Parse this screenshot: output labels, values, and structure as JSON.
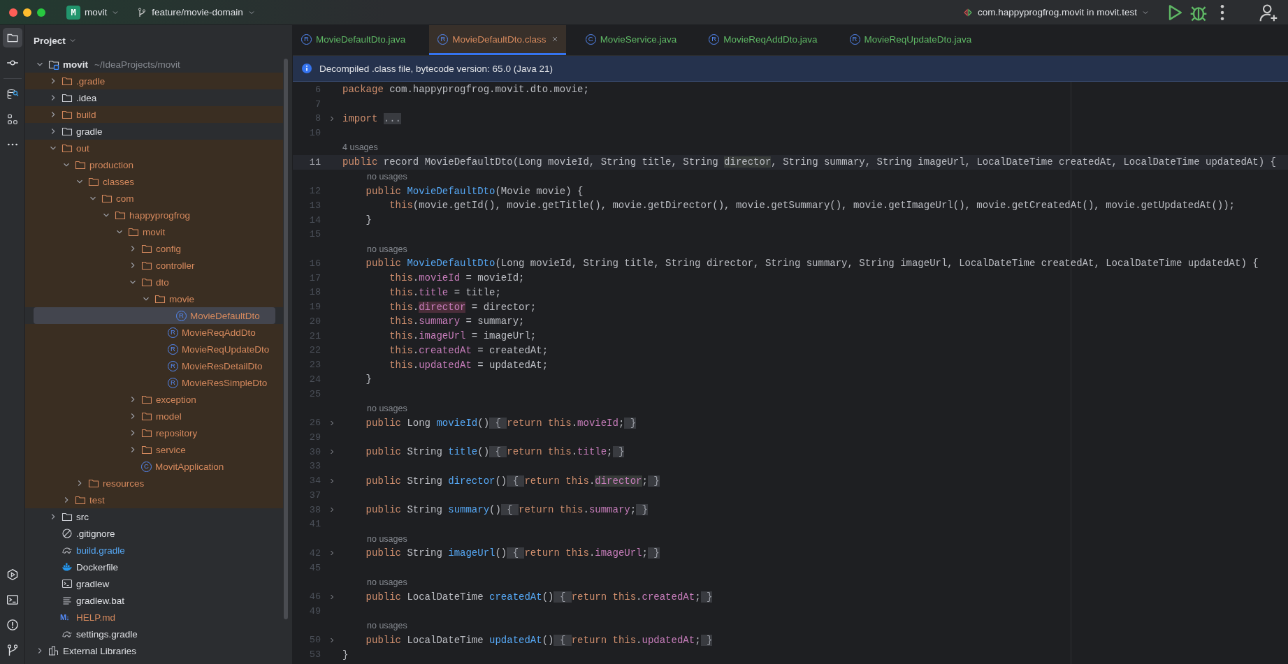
{
  "title_bar": {
    "project": {
      "glyph": "M",
      "label": "movit"
    },
    "branch": "feature/movie-domain",
    "run_config": "com.happyprogfrog.movit in movit.test"
  },
  "tool_strip": {
    "top": [
      {
        "kind": "folder",
        "selected": true
      },
      {
        "kind": "commit",
        "selected": false
      },
      {
        "kind": "database",
        "selected": false
      },
      {
        "kind": "structure",
        "selected": false
      },
      {
        "kind": "more",
        "selected": false
      }
    ],
    "bottom": [
      {
        "kind": "services",
        "selected": false
      },
      {
        "kind": "terminal",
        "selected": false
      },
      {
        "kind": "problems",
        "selected": false
      },
      {
        "kind": "git",
        "selected": false
      }
    ]
  },
  "project_panel": {
    "title": "Project",
    "tree": [
      {
        "label": "movit",
        "path": "~/IdeaProjects/movit",
        "kind": "module",
        "expanded": true,
        "highlighted": false,
        "ignored": false,
        "modified": false,
        "selected": false,
        "children": [
          {
            "label": ".gradle",
            "kind": "folder",
            "expanded": false,
            "highlighted": true,
            "ignored": true,
            "modified": false,
            "selected": false
          },
          {
            "label": ".idea",
            "kind": "folder",
            "expanded": false,
            "highlighted": false,
            "ignored": false,
            "modified": false,
            "selected": false
          },
          {
            "label": "build",
            "kind": "folder",
            "expanded": false,
            "highlighted": true,
            "ignored": true,
            "modified": false,
            "selected": false
          },
          {
            "label": "gradle",
            "kind": "folder",
            "expanded": false,
            "highlighted": false,
            "ignored": false,
            "modified": false,
            "selected": false
          },
          {
            "label": "out",
            "kind": "folder",
            "expanded": true,
            "highlighted": true,
            "ignored": true,
            "modified": false,
            "selected": false,
            "children": [
              {
                "label": "production",
                "kind": "folder",
                "expanded": true,
                "highlighted": true,
                "ignored": true,
                "modified": false,
                "selected": false,
                "children": [
                  {
                    "label": "classes",
                    "kind": "folder",
                    "expanded": true,
                    "highlighted": true,
                    "ignored": true,
                    "modified": false,
                    "selected": false,
                    "children": [
                      {
                        "label": "com",
                        "kind": "folder",
                        "expanded": true,
                        "highlighted": true,
                        "ignored": true,
                        "modified": false,
                        "selected": false,
                        "children": [
                          {
                            "label": "happyprogfrog",
                            "kind": "folder",
                            "expanded": true,
                            "highlighted": true,
                            "ignored": true,
                            "modified": false,
                            "selected": false,
                            "children": [
                              {
                                "label": "movit",
                                "kind": "folder",
                                "expanded": true,
                                "highlighted": true,
                                "ignored": true,
                                "modified": false,
                                "selected": false,
                                "children": [
                                  {
                                    "label": "config",
                                    "kind": "folder",
                                    "expanded": false,
                                    "highlighted": true,
                                    "ignored": true,
                                    "modified": false,
                                    "selected": false
                                  },
                                  {
                                    "label": "controller",
                                    "kind": "folder",
                                    "expanded": false,
                                    "highlighted": true,
                                    "ignored": true,
                                    "modified": false,
                                    "selected": false
                                  },
                                  {
                                    "label": "dto",
                                    "kind": "folder",
                                    "expanded": true,
                                    "highlighted": true,
                                    "ignored": true,
                                    "modified": false,
                                    "selected": false,
                                    "children": [
                                      {
                                        "label": "movie",
                                        "kind": "folder",
                                        "expanded": true,
                                        "highlighted": true,
                                        "ignored": true,
                                        "modified": false,
                                        "selected": false,
                                        "children": [
                                          {
                                            "label": "MovieDefaultDto",
                                            "kind": "record",
                                            "glyph": "R",
                                            "highlighted": true,
                                            "ignored": true,
                                            "modified": false,
                                            "selected": true
                                          },
                                          {
                                            "label": "MovieReqAddDto",
                                            "kind": "record",
                                            "glyph": "R",
                                            "highlighted": true,
                                            "ignored": true,
                                            "modified": false,
                                            "selected": false
                                          },
                                          {
                                            "label": "MovieReqUpdateDto",
                                            "kind": "record",
                                            "glyph": "R",
                                            "highlighted": true,
                                            "ignored": true,
                                            "modified": false,
                                            "selected": false
                                          },
                                          {
                                            "label": "MovieResDetailDto",
                                            "kind": "record",
                                            "glyph": "R",
                                            "highlighted": true,
                                            "ignored": true,
                                            "modified": false,
                                            "selected": false
                                          },
                                          {
                                            "label": "MovieResSimpleDto",
                                            "kind": "record",
                                            "glyph": "R",
                                            "highlighted": true,
                                            "ignored": true,
                                            "modified": false,
                                            "selected": false
                                          }
                                        ]
                                      }
                                    ]
                                  },
                                  {
                                    "label": "exception",
                                    "kind": "folder",
                                    "expanded": false,
                                    "highlighted": true,
                                    "ignored": true,
                                    "modified": false,
                                    "selected": false
                                  },
                                  {
                                    "label": "model",
                                    "kind": "folder",
                                    "expanded": false,
                                    "highlighted": true,
                                    "ignored": true,
                                    "modified": false,
                                    "selected": false
                                  },
                                  {
                                    "label": "repository",
                                    "kind": "folder",
                                    "expanded": false,
                                    "highlighted": true,
                                    "ignored": true,
                                    "modified": false,
                                    "selected": false
                                  },
                                  {
                                    "label": "service",
                                    "kind": "folder",
                                    "expanded": false,
                                    "highlighted": true,
                                    "ignored": true,
                                    "modified": false,
                                    "selected": false
                                  },
                                  {
                                    "label": "MovitApplication",
                                    "kind": "class",
                                    "glyph": "C",
                                    "highlighted": true,
                                    "ignored": true,
                                    "modified": false,
                                    "selected": false
                                  }
                                ]
                              }
                            ]
                          }
                        ]
                      }
                    ]
                  },
                  {
                    "label": "resources",
                    "kind": "folder",
                    "expanded": false,
                    "highlighted": true,
                    "ignored": true,
                    "modified": false,
                    "selected": false
                  }
                ]
              },
              {
                "label": "test",
                "kind": "folder",
                "expanded": false,
                "highlighted": true,
                "ignored": true,
                "modified": false,
                "selected": false
              }
            ]
          },
          {
            "label": "src",
            "kind": "folder",
            "expanded": false,
            "highlighted": false,
            "ignored": false,
            "modified": false,
            "selected": false
          },
          {
            "label": ".gitignore",
            "kind": "gitignore",
            "highlighted": false,
            "ignored": false,
            "modified": false,
            "selected": false
          },
          {
            "label": "build.gradle",
            "kind": "gradle",
            "highlighted": false,
            "ignored": false,
            "modified": true,
            "selected": false
          },
          {
            "label": "Dockerfile",
            "kind": "docker",
            "highlighted": false,
            "ignored": false,
            "modified": false,
            "selected": false
          },
          {
            "label": "gradlew",
            "kind": "script",
            "highlighted": false,
            "ignored": false,
            "modified": false,
            "selected": false
          },
          {
            "label": "gradlew.bat",
            "kind": "text",
            "highlighted": false,
            "ignored": false,
            "modified": false,
            "selected": false
          },
          {
            "label": "HELP.md",
            "kind": "markdown",
            "glyph": "M↓",
            "highlighted": false,
            "ignored": true,
            "modified": false,
            "selected": false
          },
          {
            "label": "settings.gradle",
            "kind": "gradle",
            "highlighted": false,
            "ignored": false,
            "modified": false,
            "selected": false
          }
        ]
      },
      {
        "label": "External Libraries",
        "kind": "library",
        "expanded": false,
        "highlighted": false,
        "ignored": false,
        "modified": false,
        "selected": false
      }
    ]
  },
  "tabs": [
    {
      "label": "MovieDefaultDto.java",
      "glyph": "R",
      "ignored": false,
      "selected": false
    },
    {
      "label": "MovieDefaultDto.class",
      "glyph": "R",
      "ignored": true,
      "selected": true
    },
    {
      "label": "MovieService.java",
      "glyph": "C",
      "ignored": false,
      "selected": false
    },
    {
      "label": "MovieReqAddDto.java",
      "glyph": "R",
      "ignored": false,
      "selected": false
    },
    {
      "label": "MovieReqUpdateDto.java",
      "glyph": "R",
      "ignored": false,
      "selected": false
    }
  ],
  "banner": "Decompiled .class file, bytecode version: 65.0 (Java 21)",
  "code": [
    {
      "number": "6",
      "kind": "declaration",
      "fold": false,
      "current": false,
      "tokens": [
        {
          "kind": "kw",
          "text": "package"
        },
        {
          "kind": "pl",
          "text": " com.happyprogfrog.movit.dto.movie;"
        }
      ]
    },
    {
      "number": "7",
      "fold": false,
      "current": false
    },
    {
      "number": "8",
      "kind": "declaration",
      "fold": true,
      "current": false,
      "tokens": [
        {
          "kind": "kw",
          "text": "import"
        },
        {
          "kind": "fold",
          "text": "..."
        }
      ]
    },
    {
      "number": "10",
      "fold": false,
      "current": false
    },
    {
      "hint": "4 usages",
      "kind": "declaration"
    },
    {
      "number": "11",
      "kind": "declaration",
      "fold": false,
      "current": true,
      "tokens": [
        {
          "kind": "kw",
          "text": "public"
        },
        {
          "kind": "pl",
          "text": " record MovieDefaultDto(Long movieId, String title, String "
        },
        {
          "kind": "occ",
          "text": "director"
        },
        {
          "kind": "pl",
          "text": ", String summary, String imageUrl, LocalDateTime createdAt, LocalDateTime updatedAt) {"
        }
      ]
    },
    {
      "hint": "no usages",
      "kind": "member"
    },
    {
      "number": "12",
      "kind": "member",
      "fold": false,
      "current": false,
      "tokens": [
        {
          "kind": "kw",
          "text": "public "
        },
        {
          "kind": "fn",
          "text": "MovieDefaultDto"
        },
        {
          "kind": "pl",
          "text": "(Movie movie) {"
        }
      ]
    },
    {
      "number": "13",
      "kind": "statement",
      "fold": false,
      "current": false,
      "tokens": [
        {
          "kind": "kw",
          "text": "this"
        },
        {
          "kind": "pl",
          "text": "(movie.getId(), movie.getTitle(), movie.getDirector(), movie.getSummary(), movie.getImageUrl(), movie.getCreatedAt(), movie.getUpdatedAt());"
        }
      ]
    },
    {
      "number": "14",
      "kind": "member",
      "fold": false,
      "current": false,
      "tokens": [
        {
          "kind": "pl",
          "text": "}"
        }
      ]
    },
    {
      "number": "15",
      "fold": false,
      "current": false
    },
    {
      "hint": "no usages",
      "kind": "member"
    },
    {
      "number": "16",
      "kind": "member",
      "fold": false,
      "current": false,
      "tokens": [
        {
          "kind": "kw",
          "text": "public "
        },
        {
          "kind": "fn",
          "text": "MovieDefaultDto"
        },
        {
          "kind": "pl",
          "text": "(Long movieId, String title, String director, String summary, String imageUrl, LocalDateTime createdAt, LocalDateTime updatedAt) {"
        }
      ]
    },
    {
      "number": "17",
      "kind": "statement",
      "fold": false,
      "current": false,
      "tokens": [
        {
          "kind": "kw",
          "text": "this"
        },
        {
          "kind": "pl",
          "text": "."
        },
        {
          "kind": "fd",
          "text": "movieId"
        },
        {
          "kind": "pl",
          "text": " = movieId;"
        }
      ]
    },
    {
      "number": "18",
      "kind": "statement",
      "fold": false,
      "current": false,
      "tokens": [
        {
          "kind": "kw",
          "text": "this"
        },
        {
          "kind": "pl",
          "text": "."
        },
        {
          "kind": "fd",
          "text": "title"
        },
        {
          "kind": "pl",
          "text": " = title;"
        }
      ]
    },
    {
      "number": "19",
      "kind": "statement",
      "fold": false,
      "current": false,
      "tokens": [
        {
          "kind": "kw",
          "text": "this"
        },
        {
          "kind": "pl",
          "text": "."
        },
        {
          "kind": "fd-write",
          "text": "director"
        },
        {
          "kind": "pl",
          "text": " = director;"
        }
      ]
    },
    {
      "number": "20",
      "kind": "statement",
      "fold": false,
      "current": false,
      "tokens": [
        {
          "kind": "kw",
          "text": "this"
        },
        {
          "kind": "pl",
          "text": "."
        },
        {
          "kind": "fd",
          "text": "summary"
        },
        {
          "kind": "pl",
          "text": " = summary;"
        }
      ]
    },
    {
      "number": "21",
      "kind": "statement",
      "fold": false,
      "current": false,
      "tokens": [
        {
          "kind": "kw",
          "text": "this"
        },
        {
          "kind": "pl",
          "text": "."
        },
        {
          "kind": "fd",
          "text": "imageUrl"
        },
        {
          "kind": "pl",
          "text": " = imageUrl;"
        }
      ]
    },
    {
      "number": "22",
      "kind": "statement",
      "fold": false,
      "current": false,
      "tokens": [
        {
          "kind": "kw",
          "text": "this"
        },
        {
          "kind": "pl",
          "text": "."
        },
        {
          "kind": "fd",
          "text": "createdAt"
        },
        {
          "kind": "pl",
          "text": " = createdAt;"
        }
      ]
    },
    {
      "number": "23",
      "kind": "statement",
      "fold": false,
      "current": false,
      "tokens": [
        {
          "kind": "kw",
          "text": "this"
        },
        {
          "kind": "pl",
          "text": "."
        },
        {
          "kind": "fd",
          "text": "updatedAt"
        },
        {
          "kind": "pl",
          "text": " = updatedAt;"
        }
      ]
    },
    {
      "number": "24",
      "kind": "member",
      "fold": false,
      "current": false,
      "tokens": [
        {
          "kind": "pl",
          "text": "}"
        }
      ]
    },
    {
      "number": "25",
      "fold": false,
      "current": false
    },
    {
      "hint": "no usages",
      "kind": "member"
    },
    {
      "number": "26",
      "kind": "member",
      "fold": true,
      "current": false,
      "tokens": [
        {
          "kind": "kw",
          "text": "public"
        },
        {
          "kind": "pl",
          "text": " Long "
        },
        {
          "kind": "fn",
          "text": "movieId"
        },
        {
          "kind": "pl",
          "text": "()"
        },
        {
          "kind": "fold-open",
          "text": "{"
        },
        {
          "kind": "kw",
          "text": "return this"
        },
        {
          "kind": "pl",
          "text": "."
        },
        {
          "kind": "fd",
          "text": "movieId"
        },
        {
          "kind": "pl",
          "text": ";"
        },
        {
          "kind": "fold-close",
          "text": "}"
        }
      ]
    },
    {
      "number": "29",
      "fold": false,
      "current": false
    },
    {
      "number": "30",
      "kind": "member",
      "fold": true,
      "current": false,
      "tokens": [
        {
          "kind": "kw",
          "text": "public"
        },
        {
          "kind": "pl",
          "text": " String "
        },
        {
          "kind": "fn",
          "text": "title"
        },
        {
          "kind": "pl",
          "text": "()"
        },
        {
          "kind": "fold-open",
          "text": "{"
        },
        {
          "kind": "kw",
          "text": "return this"
        },
        {
          "kind": "pl",
          "text": "."
        },
        {
          "kind": "fd",
          "text": "title"
        },
        {
          "kind": "pl",
          "text": ";"
        },
        {
          "kind": "fold-close",
          "text": "}"
        }
      ]
    },
    {
      "number": "33",
      "fold": false,
      "current": false
    },
    {
      "number": "34",
      "kind": "member",
      "fold": true,
      "current": false,
      "tokens": [
        {
          "kind": "kw",
          "text": "public"
        },
        {
          "kind": "pl",
          "text": " String "
        },
        {
          "kind": "fn",
          "text": "director"
        },
        {
          "kind": "pl",
          "text": "()"
        },
        {
          "kind": "fold-open",
          "text": "{"
        },
        {
          "kind": "kw",
          "text": "return this"
        },
        {
          "kind": "pl",
          "text": "."
        },
        {
          "kind": "fd-read",
          "text": "director"
        },
        {
          "kind": "pl",
          "text": ";"
        },
        {
          "kind": "fold-close",
          "text": "}"
        }
      ]
    },
    {
      "number": "37",
      "fold": false,
      "current": false
    },
    {
      "number": "38",
      "kind": "member",
      "fold": true,
      "current": false,
      "tokens": [
        {
          "kind": "kw",
          "text": "public"
        },
        {
          "kind": "pl",
          "text": " String "
        },
        {
          "kind": "fn",
          "text": "summary"
        },
        {
          "kind": "pl",
          "text": "()"
        },
        {
          "kind": "fold-open",
          "text": "{"
        },
        {
          "kind": "kw",
          "text": "return this"
        },
        {
          "kind": "pl",
          "text": "."
        },
        {
          "kind": "fd",
          "text": "summary"
        },
        {
          "kind": "pl",
          "text": ";"
        },
        {
          "kind": "fold-close",
          "text": "}"
        }
      ]
    },
    {
      "number": "41",
      "fold": false,
      "current": false
    },
    {
      "hint": "no usages",
      "kind": "member"
    },
    {
      "number": "42",
      "kind": "member",
      "fold": true,
      "current": false,
      "tokens": [
        {
          "kind": "kw",
          "text": "public"
        },
        {
          "kind": "pl",
          "text": " String "
        },
        {
          "kind": "fn",
          "text": "imageUrl"
        },
        {
          "kind": "pl",
          "text": "()"
        },
        {
          "kind": "fold-open",
          "text": "{"
        },
        {
          "kind": "kw",
          "text": "return this"
        },
        {
          "kind": "pl",
          "text": "."
        },
        {
          "kind": "fd",
          "text": "imageUrl"
        },
        {
          "kind": "pl",
          "text": ";"
        },
        {
          "kind": "fold-close",
          "text": "}"
        }
      ]
    },
    {
      "number": "45",
      "fold": false,
      "current": false
    },
    {
      "hint": "no usages",
      "kind": "member"
    },
    {
      "number": "46",
      "kind": "member",
      "fold": true,
      "current": false,
      "tokens": [
        {
          "kind": "kw",
          "text": "public"
        },
        {
          "kind": "pl",
          "text": " LocalDateTime "
        },
        {
          "kind": "fn",
          "text": "createdAt"
        },
        {
          "kind": "pl",
          "text": "()"
        },
        {
          "kind": "fold-open",
          "text": "{"
        },
        {
          "kind": "kw",
          "text": "return this"
        },
        {
          "kind": "pl",
          "text": "."
        },
        {
          "kind": "fd",
          "text": "createdAt"
        },
        {
          "kind": "pl",
          "text": ";"
        },
        {
          "kind": "fold-close",
          "text": "}"
        }
      ]
    },
    {
      "number": "49",
      "fold": false,
      "current": false
    },
    {
      "hint": "no usages",
      "kind": "member"
    },
    {
      "number": "50",
      "kind": "member",
      "fold": true,
      "current": false,
      "tokens": [
        {
          "kind": "kw",
          "text": "public"
        },
        {
          "kind": "pl",
          "text": " LocalDateTime "
        },
        {
          "kind": "fn",
          "text": "updatedAt"
        },
        {
          "kind": "pl",
          "text": "()"
        },
        {
          "kind": "fold-open",
          "text": "{"
        },
        {
          "kind": "kw",
          "text": "return this"
        },
        {
          "kind": "pl",
          "text": "."
        },
        {
          "kind": "fd",
          "text": "updatedAt"
        },
        {
          "kind": "pl",
          "text": ";"
        },
        {
          "kind": "fold-close",
          "text": "}"
        }
      ]
    },
    {
      "number": "53",
      "kind": "declaration",
      "fold": false,
      "current": false,
      "tokens": [
        {
          "kind": "pl",
          "text": "}"
        }
      ]
    }
  ]
}
